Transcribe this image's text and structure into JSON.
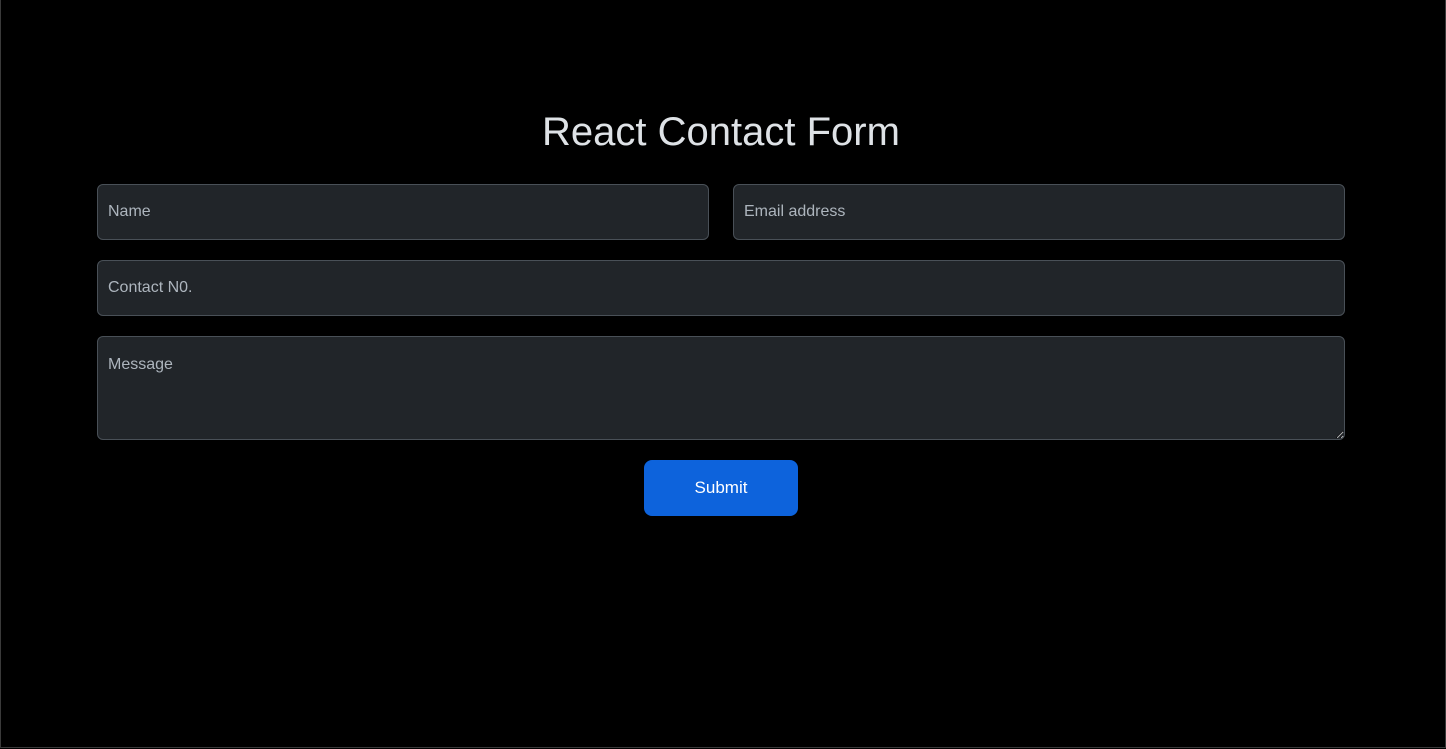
{
  "form": {
    "title": "React Contact Form",
    "name_placeholder": "Name",
    "email_placeholder": "Email address",
    "contact_placeholder": "Contact N0.",
    "message_placeholder": "Message",
    "submit_label": "Submit"
  },
  "colors": {
    "background": "#000000",
    "field_background": "#212529",
    "field_border": "#495057",
    "placeholder_text": "#adb5bd",
    "title_text": "#dee2e6",
    "submit_background": "#0d63dc",
    "submit_text": "#ffffff"
  }
}
